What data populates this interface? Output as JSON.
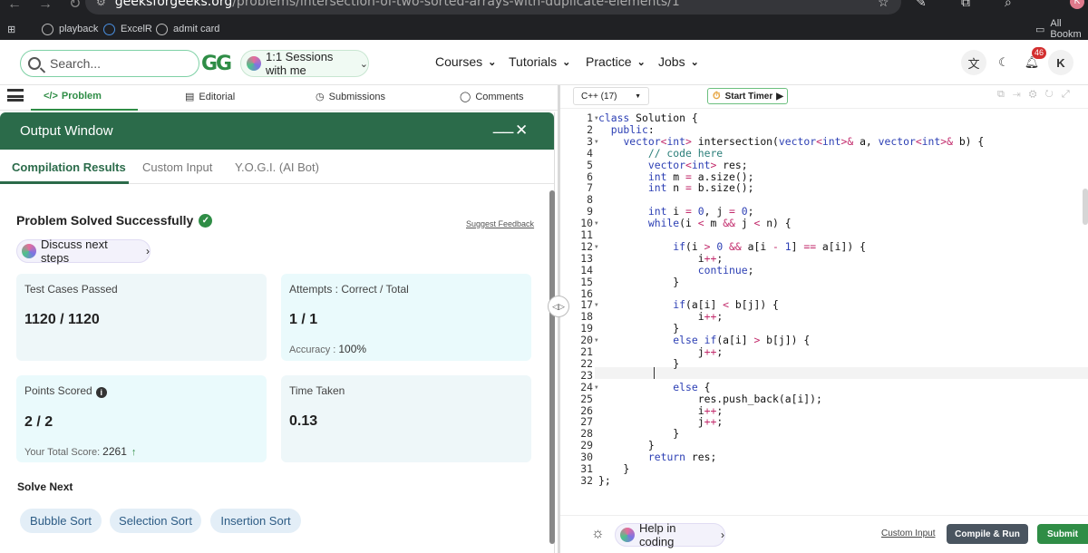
{
  "browser": {
    "url_host": "geeksforgeeks.org",
    "url_path": "/problems/intersection-of-two-sorted-arrays-with-duplicate-elements/1",
    "bookmarks": [
      "playback",
      "ExcelR",
      "admit card"
    ],
    "all_bookmarks": "All Bookm",
    "profile_initial": "K"
  },
  "header": {
    "search_placeholder": "Search...",
    "logo": "GG",
    "sessions_label": "1:1 Sessions with me",
    "nav": [
      "Courses",
      "Tutorials",
      "Practice",
      "Jobs"
    ],
    "notification_count": "46",
    "user_initial": "K"
  },
  "problem_tabs": [
    "Problem",
    "Editorial",
    "Submissions",
    "Comments"
  ],
  "output_window": {
    "title": "Output Window",
    "minimize": "__",
    "close": "✕",
    "tabs": [
      "Compilation Results",
      "Custom Input",
      "Y.O.G.I. (AI Bot)"
    ],
    "status": "Problem Solved Successfully",
    "suggest_feedback": "Suggest Feedback",
    "discuss_label": "Discuss next steps",
    "cards": {
      "test_cases_label": "Test Cases Passed",
      "test_cases_value": "1120 / 1120",
      "attempts_label": "Attempts : Correct / Total",
      "attempts_value": "1 / 1",
      "accuracy_label": "Accuracy :",
      "accuracy_value": "100%",
      "points_label": "Points Scored",
      "points_value": "2 / 2",
      "total_score_label": "Your Total Score:",
      "total_score_value": "2261",
      "time_label": "Time Taken",
      "time_value": "0.13"
    },
    "solve_next_label": "Solve Next",
    "solve_next": [
      "Bubble Sort",
      "Selection Sort",
      "Insertion Sort"
    ]
  },
  "editor": {
    "language": "C++ (17)",
    "timer_label": "Start Timer",
    "help_label": "Help in coding",
    "custom_input": "Custom Input",
    "compile_run": "Compile & Run",
    "submit": "Submit",
    "lines": [
      "class Solution {",
      "  public:",
      "    vector<int> intersection(vector<int>& a, vector<int>& b) {",
      "        // code here",
      "        vector<int> res;",
      "        int m = a.size();",
      "        int n = b.size();",
      "",
      "        int i = 0, j = 0;",
      "        while(i < m && j < n) {",
      "",
      "            if(i > 0 && a[i - 1] == a[i]) {",
      "                i++;",
      "                continue;",
      "            }",
      "",
      "            if(a[i] < b[j]) {",
      "                i++;",
      "            }",
      "            else if(a[i] > b[j]) {",
      "                j++;",
      "            }",
      "",
      "            else {",
      "                res.push_back(a[i]);",
      "                i++;",
      "                j++;",
      "            }",
      "        }",
      "        return res;",
      "    }",
      "};"
    ],
    "folded_lines": [
      1,
      3,
      10,
      12,
      17,
      20,
      24
    ]
  }
}
